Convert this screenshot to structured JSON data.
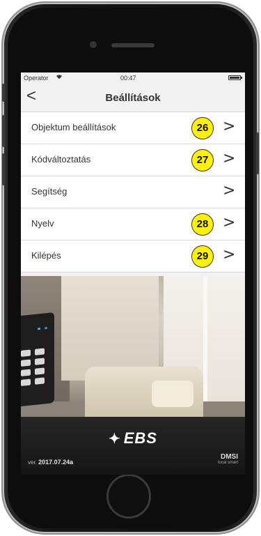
{
  "status_bar": {
    "carrier": "Operator",
    "wifi_icon": "wifi-icon",
    "time": "00:47",
    "battery_icon": "battery-icon"
  },
  "nav": {
    "back_icon": "chevron-left-icon",
    "back_glyph": "<",
    "title": "Beállítások"
  },
  "menu": {
    "items": [
      {
        "label": "Objektum beállítások",
        "badge": "26",
        "chevron": ">"
      },
      {
        "label": "Kódváltoztatás",
        "badge": "27",
        "chevron": ">"
      },
      {
        "label": "Segítség",
        "badge": "",
        "chevron": ">"
      },
      {
        "label": "Nyelv",
        "badge": "28",
        "chevron": ">"
      },
      {
        "label": "Kilépés",
        "badge": "29",
        "chevron": ">"
      }
    ]
  },
  "footer": {
    "logo_text": "EBS",
    "version_prefix": "ver.",
    "version": "2017.07.24a",
    "partner_text": "DMSI",
    "partner_subtext": "local smart"
  },
  "colors": {
    "badge_fill": "#fff200",
    "footer_bg": "#1f1f1f",
    "nav_bg": "#f3f3f3"
  }
}
